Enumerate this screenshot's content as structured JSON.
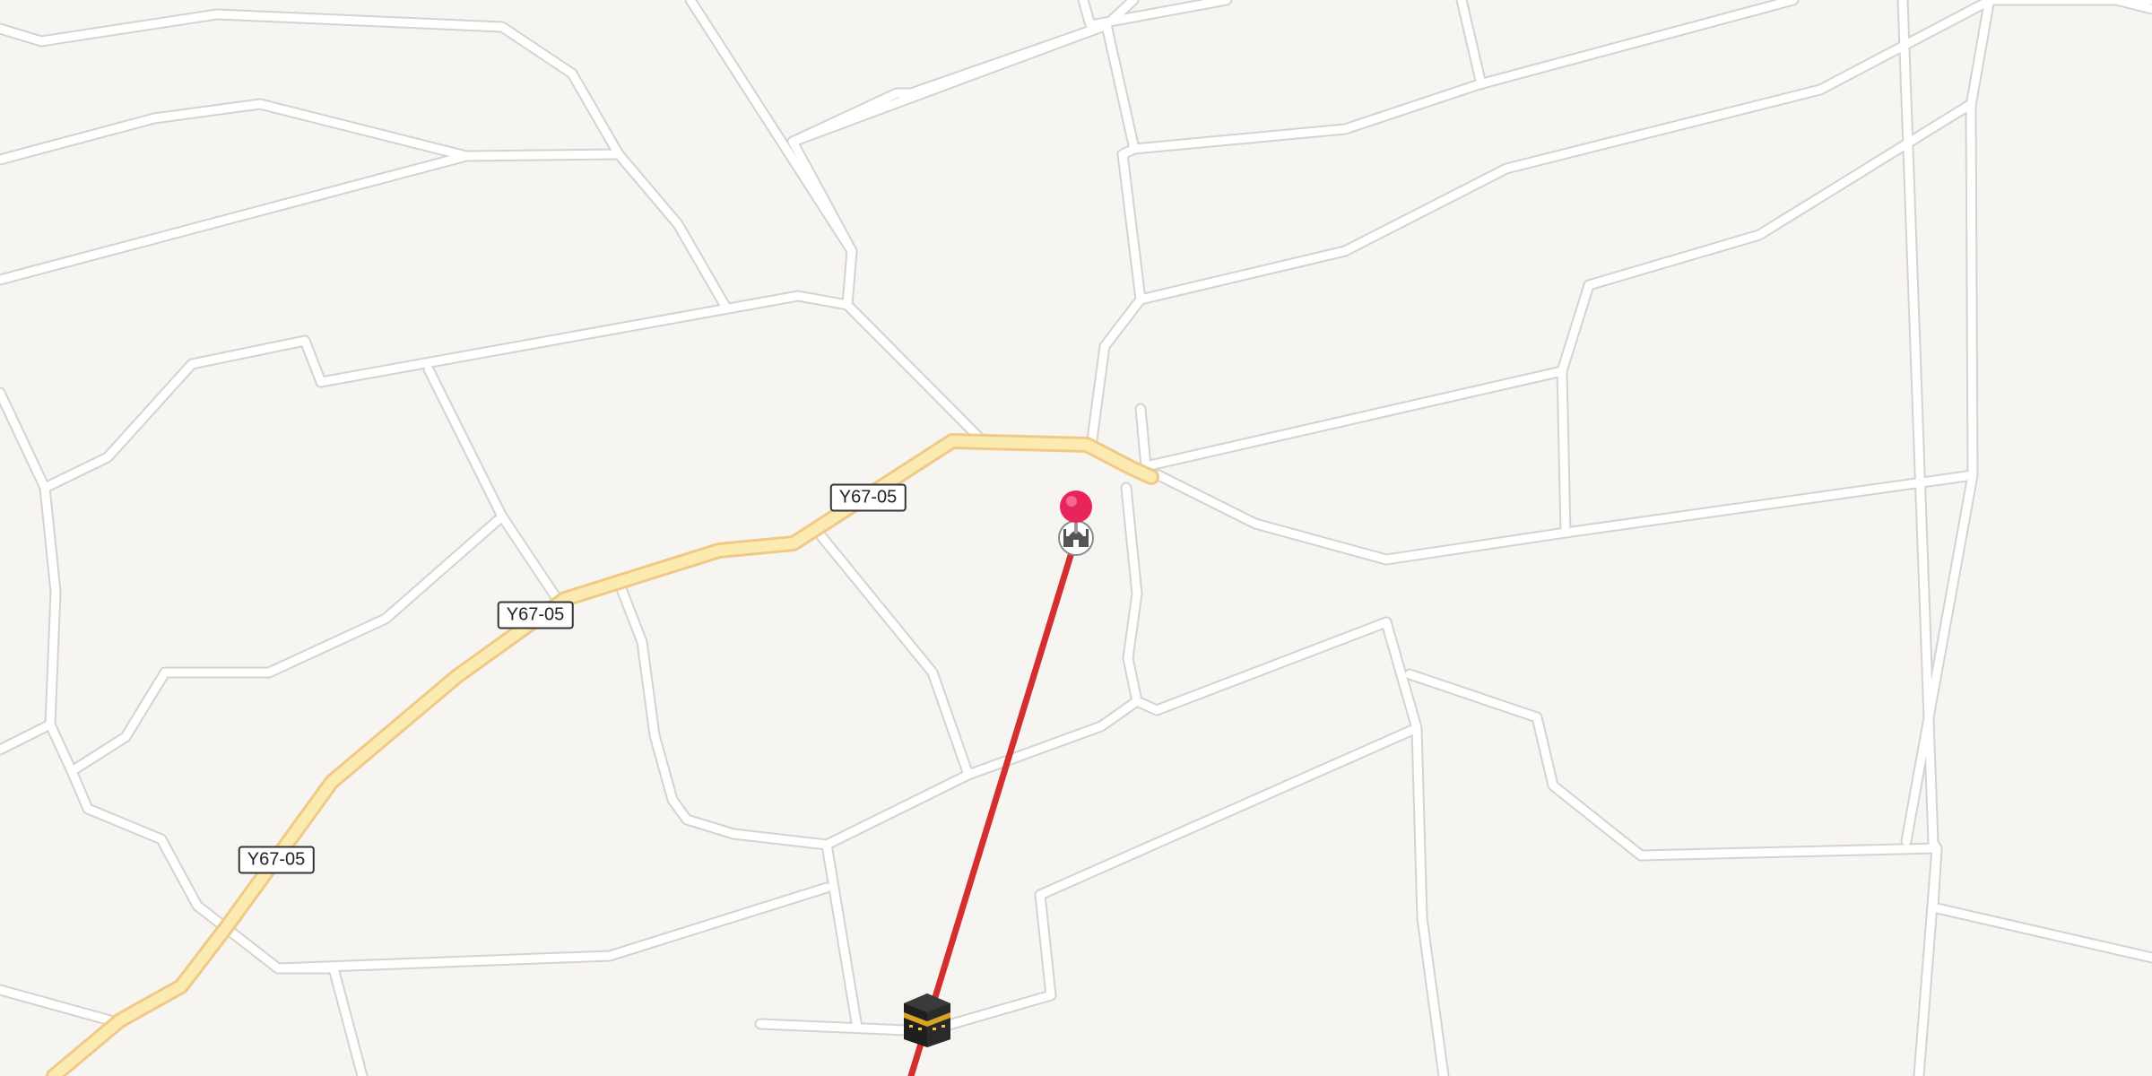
{
  "map": {
    "background_color": "#f7f5f2",
    "road_color": "#ffffff",
    "major_road_color": "#fcebb0",
    "route_color": "#d62d2d",
    "pin_color": "#e8245a"
  },
  "road_labels": [
    {
      "text": "Y67-05"
    },
    {
      "text": "Y67-05"
    },
    {
      "text": "Y67-05"
    }
  ],
  "markers": {
    "location_pin": {
      "icon": "map-pin-icon"
    },
    "mosque": {
      "icon": "mosque-icon"
    },
    "kaaba": {
      "icon": "kaaba-icon"
    }
  }
}
